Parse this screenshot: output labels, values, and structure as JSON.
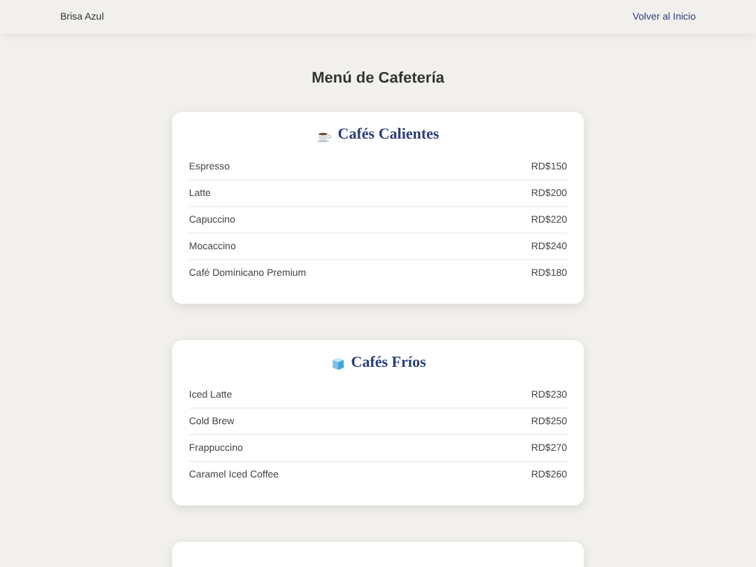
{
  "header": {
    "brand": "Brisa Azul",
    "link": "Volver al Inicio"
  },
  "title": "Menú de Cafetería",
  "sections": [
    {
      "kind": "hot",
      "title": "Cafés Calientes",
      "items": [
        {
          "name": "Espresso",
          "price": "RD$150"
        },
        {
          "name": "Latte",
          "price": "RD$200"
        },
        {
          "name": "Capuccino",
          "price": "RD$220"
        },
        {
          "name": "Mocaccino",
          "price": "RD$240"
        },
        {
          "name": "Café Dominicano Premium",
          "price": "RD$180"
        }
      ]
    },
    {
      "kind": "cold",
      "title": "Cafés Fríos",
      "items": [
        {
          "name": "Iced Latte",
          "price": "RD$230"
        },
        {
          "name": "Cold Brew",
          "price": "RD$250"
        },
        {
          "name": "Frappuccino",
          "price": "RD$270"
        },
        {
          "name": "Caramel Iced Coffee",
          "price": "RD$260"
        }
      ]
    }
  ]
}
